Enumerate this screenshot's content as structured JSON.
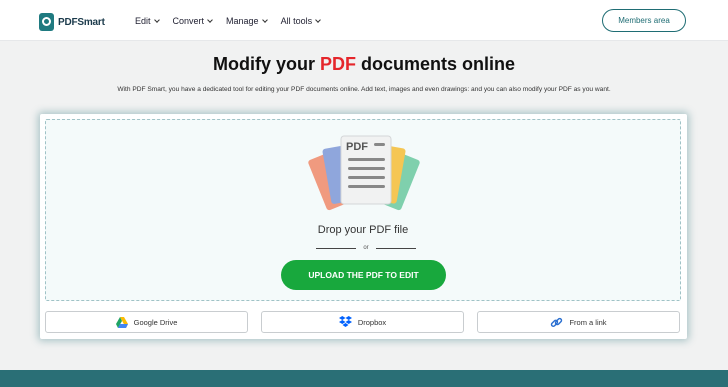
{
  "header": {
    "logo_text": "PDFSmart",
    "nav": [
      {
        "label": "Edit"
      },
      {
        "label": "Convert"
      },
      {
        "label": "Manage"
      },
      {
        "label": "All tools"
      }
    ],
    "members_label": "Members area"
  },
  "hero": {
    "title_before": "Modify your ",
    "title_accent": "PDF",
    "title_after": " documents online",
    "subtitle": "With PDF Smart, you have a dedicated tool for editing your PDF documents online. Add text, images and even drawings: and you can also modify your PDF as you want."
  },
  "upload": {
    "illustration_label": "PDF",
    "drop_text": "Drop your PDF file",
    "or_text": "or",
    "upload_button": "UPLOAD THE PDF TO EDIT",
    "sources": [
      {
        "label": "Google Drive",
        "icon": "google-drive-icon"
      },
      {
        "label": "Dropbox",
        "icon": "dropbox-icon"
      },
      {
        "label": "From a link",
        "icon": "link-icon"
      }
    ]
  },
  "colors": {
    "brand_teal": "#1f6d74",
    "accent_red": "#e5262b",
    "upload_green": "#18a83d",
    "footer_band": "#2a6f76"
  }
}
